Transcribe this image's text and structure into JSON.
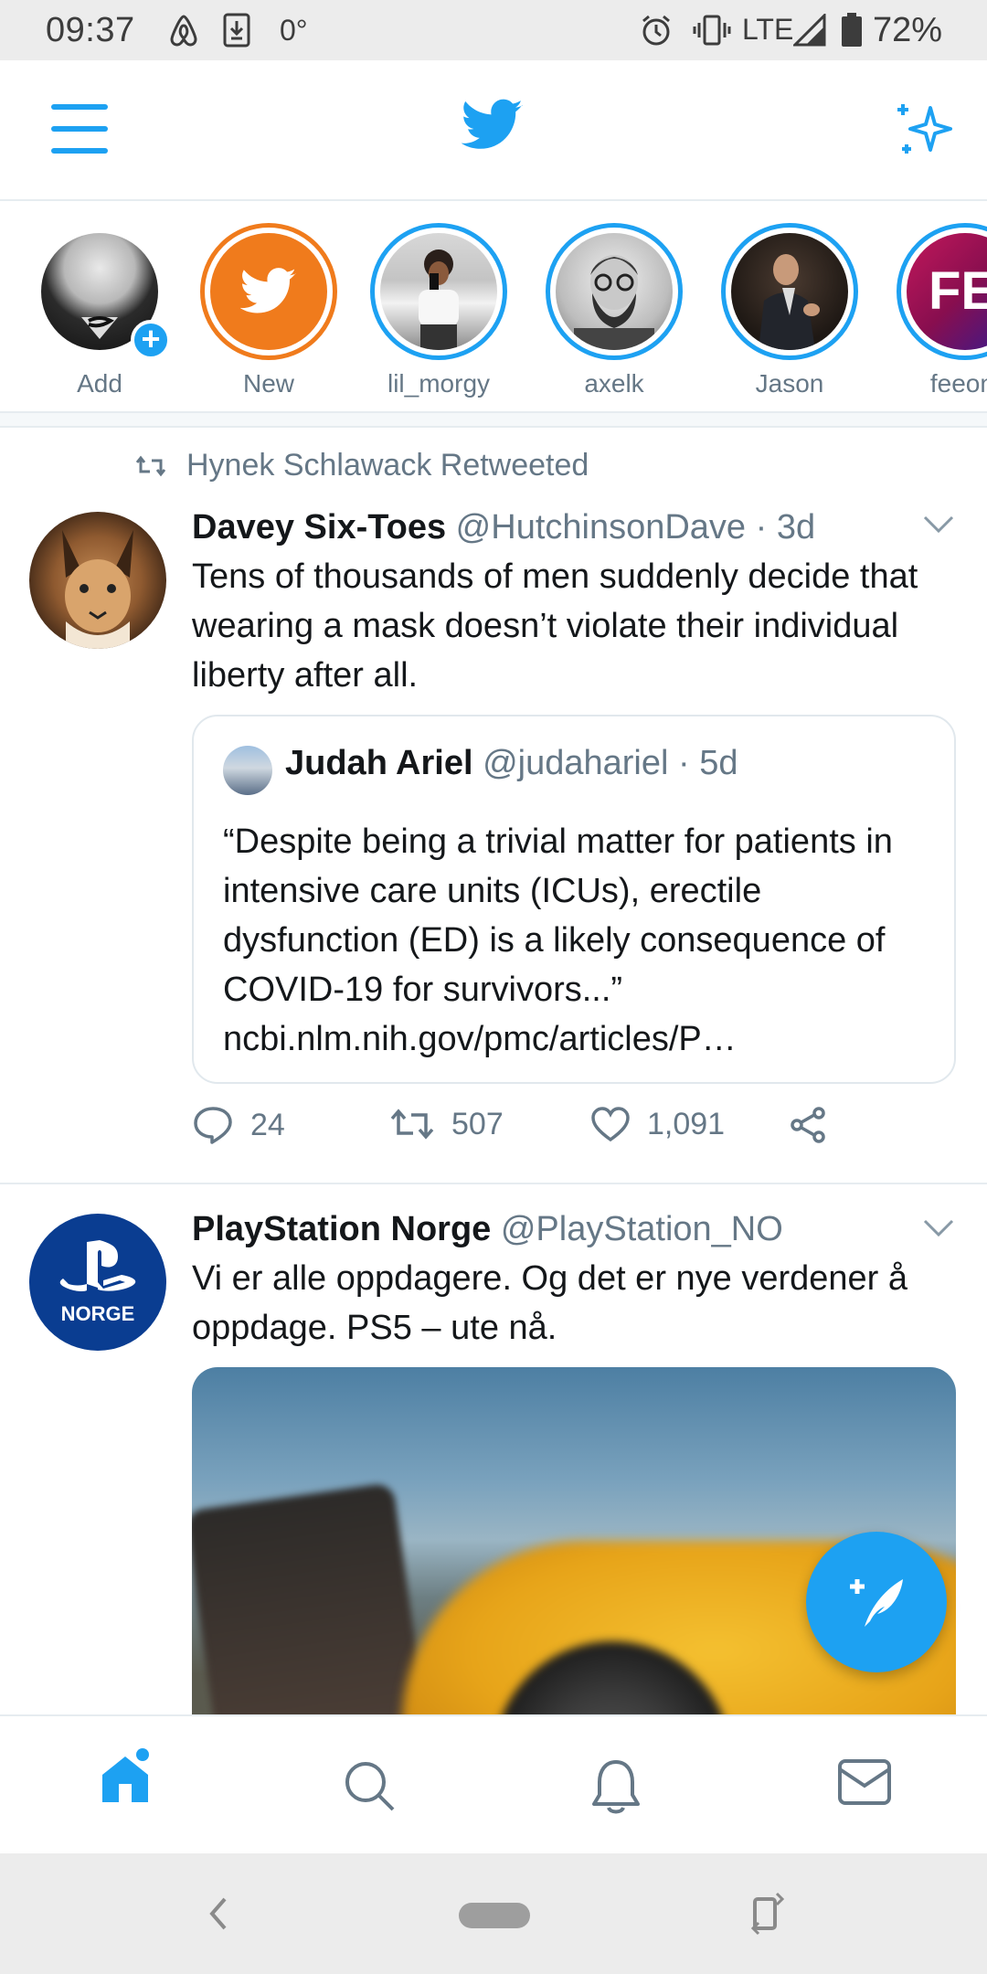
{
  "status_bar": {
    "time": "09:37",
    "temperature": "0°",
    "network": "LTE",
    "battery": "72%"
  },
  "app_bar": {
    "menu_icon": "hamburger-menu-icon",
    "logo_icon": "twitter-bird-icon",
    "sparkle_icon": "sparkle-icon"
  },
  "fleets": [
    {
      "label": "Add"
    },
    {
      "label": "New"
    },
    {
      "label": "lil_morgy"
    },
    {
      "label": "axelk"
    },
    {
      "label": "Jason"
    },
    {
      "label": "feeonl"
    }
  ],
  "fleet_partial_text": "FE",
  "tweet1": {
    "retweet_context": "Hynek Schlawack Retweeted",
    "name": "Davey Six-Toes",
    "handle": "@HutchinsonDave · 3d",
    "text": "Tens of thousands of men suddenly decide that wearing a mask doesn’t violate their individual liberty after all.",
    "quote": {
      "name": "Judah Ariel",
      "handle": "@judahariel · 5d",
      "text": "“Despite being a trivial matter for patients in intensive care units (ICUs), erectile dysfunction (ED) is a likely consequence of COVID-19 for survivors...”",
      "link": "ncbi.nlm.nih.gov/pmc/articles/P…"
    },
    "replies": "24",
    "retweets": "507",
    "likes": "1,091"
  },
  "tweet2": {
    "name": "PlayStation Norge",
    "handle": "@PlayStation_NO",
    "avatar_label": "NORGE",
    "text": "Vi er alle oppdagere. Og det er nye verdener å oppdage. PS5 – ute nå."
  },
  "colors": {
    "accent": "#1da1f2",
    "secondary_text": "#657786",
    "primary_text": "#14171a"
  }
}
